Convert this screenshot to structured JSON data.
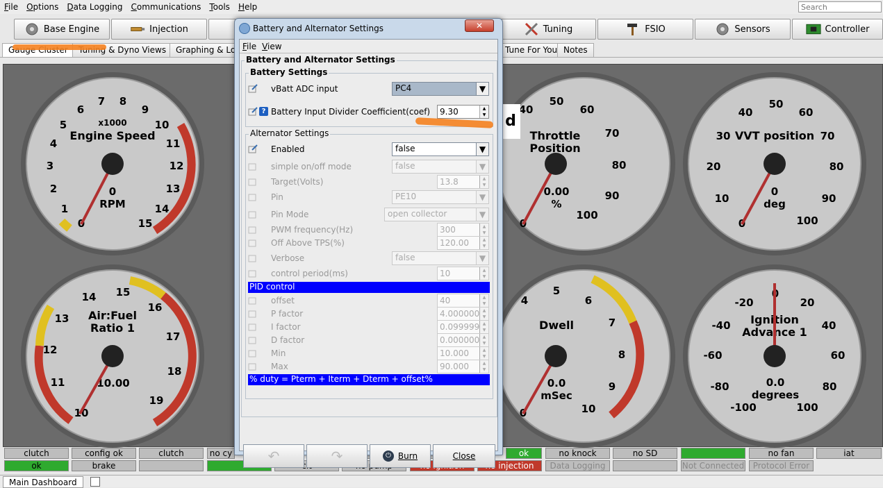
{
  "menu": {
    "items": [
      "File",
      "Options",
      "Data Logging",
      "Communications",
      "Tools",
      "Help"
    ],
    "search_placeholder": "Search"
  },
  "toolbar": {
    "buttons": [
      "Base Engine",
      "Injection",
      "Tuning",
      "FSIO",
      "Sensors",
      "Controller"
    ]
  },
  "tabs": {
    "items": [
      "Gauge Cluster",
      "Tuning & Dyno Views",
      "Graphing & Log",
      "Tune For You",
      "Notes"
    ]
  },
  "gauges": {
    "rpm": {
      "title": "Engine Speed",
      "mult": "x1000",
      "value": "0",
      "unit": "RPM",
      "ticks": [
        "0",
        "1",
        "2",
        "3",
        "4",
        "5",
        "6",
        "7",
        "8",
        "9",
        "10",
        "11",
        "12",
        "13",
        "14",
        "15"
      ]
    },
    "throttle": {
      "title1": "Throttle",
      "title2": "Position",
      "value": "0.00",
      "unit": "%",
      "ticks": [
        "0",
        "40",
        "50",
        "60",
        "70",
        "80",
        "90",
        "100"
      ]
    },
    "vvt": {
      "title": "VVT position",
      "value": "0",
      "unit": "deg",
      "ticks": [
        "0",
        "10",
        "20",
        "30",
        "40",
        "50",
        "60",
        "70",
        "80",
        "90",
        "100"
      ]
    },
    "afr": {
      "title1": "Air:Fuel",
      "title2": "Ratio 1",
      "value": "10.00",
      "unit": "",
      "ticks": [
        "10",
        "11",
        "12",
        "13",
        "14",
        "15",
        "16",
        "17",
        "18",
        "19"
      ]
    },
    "dwell": {
      "title": "Dwell",
      "value": "0.0",
      "unit": "mSec",
      "ticks": [
        "0",
        "4",
        "5",
        "6",
        "7",
        "8",
        "9",
        "10"
      ]
    },
    "ign": {
      "title1": "Ignition",
      "title2": "Advance 1",
      "value": "0.0",
      "unit": "degrees",
      "ticks": [
        "-100",
        "-80",
        "-60",
        "-40",
        "-20",
        "0",
        "20",
        "40",
        "60",
        "80",
        "100"
      ]
    },
    "partial_label": "d"
  },
  "indicators": {
    "row1": [
      "clutch",
      "config ok",
      "clutch",
      "no cy",
      "",
      "",
      "ok",
      "no knock",
      "no SD",
      "",
      "no fan",
      "iat"
    ],
    "row2": [
      "ok",
      "brake",
      "",
      "",
      "clt",
      "no pump",
      "no ignition",
      "no injection",
      "Data Logging",
      "",
      "Not Connected",
      "Protocol Error"
    ]
  },
  "bottom": {
    "tab": "Main Dashboard"
  },
  "dialog": {
    "title": "Battery and Alternator Settings",
    "menu": [
      "File",
      "View"
    ],
    "heading": "Battery and Alternator Settings",
    "battery": {
      "legend": "Battery Settings",
      "vbatt_label": "vBatt ADC input",
      "vbatt_value": "PC4",
      "coef_label": "Battery Input Divider Coefficient(coef)",
      "coef_value": "9.30"
    },
    "alternator": {
      "legend": "Alternator Settings",
      "enabled_label": "Enabled",
      "enabled_value": "false",
      "simple_label": "simple on/off mode",
      "simple_value": "false",
      "target_label": "Target(Volts)",
      "target_value": "13.8",
      "pin_label": "Pin",
      "pin_value": "PE10",
      "pinmode_label": "Pin Mode",
      "pinmode_value": "open collector",
      "pwm_label": "PWM frequency(Hz)",
      "pwm_value": "300",
      "offtps_label": "Off Above TPS(%)",
      "offtps_value": "120.00",
      "verbose_label": "Verbose",
      "verbose_value": "false",
      "period_label": "control period(ms)",
      "period_value": "10"
    },
    "pid": {
      "header": "PID control",
      "offset_label": "offset",
      "offset_value": "40",
      "p_label": "P factor",
      "p_value": "4.0000000",
      "i_label": "I factor",
      "i_value": "0.0999999",
      "d_label": "D factor",
      "d_value": "0.0000000",
      "min_label": "Min",
      "min_value": "10.000",
      "max_label": "Max",
      "max_value": "90.000",
      "formula": "% duty = Pterm + Iterm + Dterm + offset%"
    },
    "buttons": {
      "burn": "Burn",
      "close": "Close"
    }
  }
}
